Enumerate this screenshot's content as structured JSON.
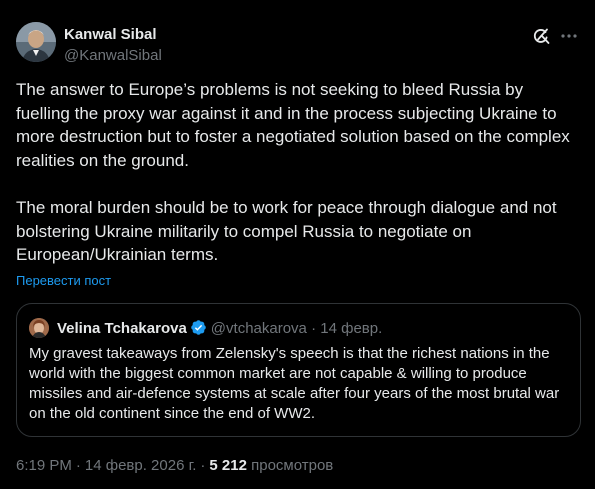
{
  "author": {
    "display_name": "Kanwal Sibal",
    "handle": "@KanwalSibal"
  },
  "tweet": {
    "text": "The answer to Europe’s problems is not seeking to bleed Russia by fuelling the proxy war against it and in the process subjecting Ukraine to more destruction but to foster a negotiated solution based on the complex realities on the ground.\n\nThe moral burden should be to work for peace through dialogue and not bolstering Ukraine militarily to compel Russia to negotiate on European/Ukrainian terms.",
    "translate_label": "Перевести пост"
  },
  "quote": {
    "display_name": "Velina Tchakarova",
    "handle": "@vtchakarova",
    "separator": "·",
    "date": "14 февр.",
    "text": "My gravest takeaways from Zelensky's speech is that the richest nations in the world with the biggest common market are not capable & willing to produce missiles and air-defence systems at scale after four years of the most brutal war on the old continent since the end of WW2."
  },
  "footer": {
    "time": "6:19 PM",
    "separator": "·",
    "date": "14 февр. 2026 г.",
    "views_count": "5 212",
    "views_label": "просмотров"
  },
  "colors": {
    "background": "#000000",
    "text": "#e7e9ea",
    "muted": "#71767b",
    "link": "#1d9bf0",
    "border": "#2f3336",
    "verified": "#1d9bf0"
  },
  "icons": [
    "grok-icon",
    "more-icon",
    "verified-badge-icon"
  ]
}
